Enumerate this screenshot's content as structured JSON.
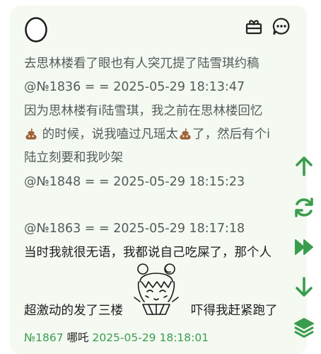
{
  "post": {
    "icons": {
      "avatar": "egg-avatar-icon",
      "gift": "gift-icon",
      "comment": "comment-icon",
      "poop": "poop-emoji-icon",
      "sticker": "anime-girl-sticker"
    },
    "lines": {
      "l1": "去思林楼看了眼也有人突兀提了陆雪琪约稿",
      "l2": "@№1836 = = 2025-05-29 18:13:47",
      "l3": "因为思林楼有i陆雪琪，我之前在思林楼回忆",
      "l4": "的时候，说我嗑过凡瑶太",
      "l4b": "了，然后有个i",
      "l5": "陆立刻要和我吵架",
      "l6": "@№1848 = = 2025-05-29 18:15:23",
      "l7": "@№1863 = = 2025-05-29 18:17:18",
      "l8": "当时我就很无语，我都说自己吃屎了，那个人",
      "l9": "超激动的发了三楼",
      "l9b": "吓得我赶紧跑了"
    },
    "footer": {
      "number": "№1867",
      "user": "哪吒",
      "time": "2025-05-29 18:18:01"
    }
  },
  "side_actions": {
    "scroll_up": "arrow-up-icon",
    "refresh": "refresh-icon",
    "fast_forward": "fast-forward-icon",
    "scroll_down": "arrow-down-icon",
    "layers": "layers-icon"
  },
  "colors": {
    "accent": "#3a9d4d",
    "card_bg": "#f4f9f2",
    "text_grey": "#555b59",
    "text_dark": "#1d1d1d"
  }
}
